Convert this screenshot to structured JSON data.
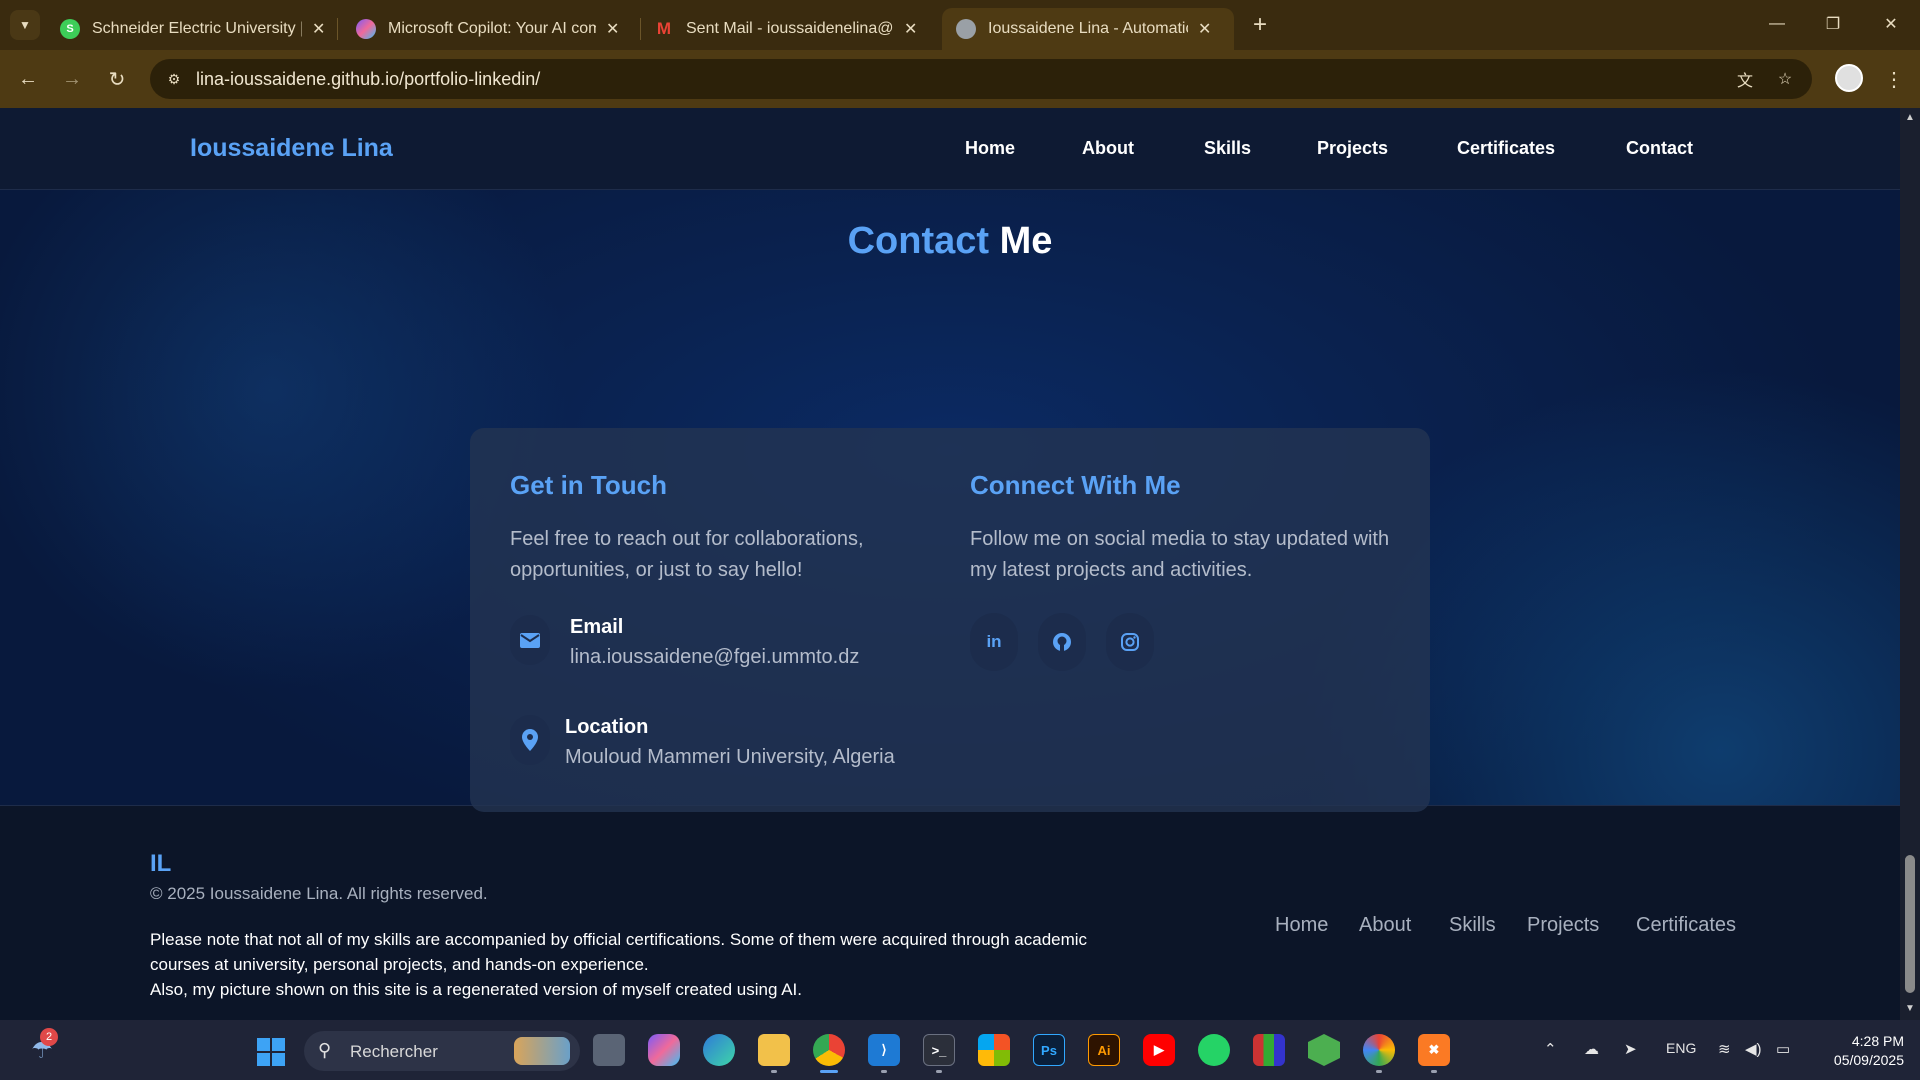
{
  "browser": {
    "tabs": [
      {
        "title": "Schneider Electric University | b",
        "favicon": "schneider-icon",
        "color": "#3dcd58"
      },
      {
        "title": "Microsoft Copilot: Your AI comp",
        "favicon": "copilot-icon",
        "color": "#7a5af8"
      },
      {
        "title": "Sent Mail - ioussaidenelina@gm",
        "favicon": "gmail-icon",
        "color": "#ea4335"
      },
      {
        "title": "Ioussaidene Lina - Automation",
        "favicon": "globe-icon",
        "color": "#9aa0a6"
      }
    ],
    "url_host": "lina-ioussaidene.github.io",
    "url_path": "/portfolio-linkedin/"
  },
  "site": {
    "brand": "Ioussaidene Lina",
    "nav": [
      "Home",
      "About",
      "Skills",
      "Projects",
      "Certificates",
      "Contact"
    ]
  },
  "contact": {
    "title_highlight": "Contact",
    "title_rest": "Me",
    "touch": {
      "title": "Get in Touch",
      "text": "Feel free to reach out for collaborations, opportunities, or just to say hello!",
      "email_label": "Email",
      "email_value": "lina.ioussaidene@fgei.ummto.dz",
      "location_label": "Location",
      "location_value": "Mouloud Mammeri University, Algeria"
    },
    "connect": {
      "title": "Connect With Me",
      "text": "Follow me on social media to stay updated with my latest projects and activities.",
      "socials": [
        "linkedin-icon",
        "github-icon",
        "instagram-icon"
      ]
    }
  },
  "footer": {
    "logo": "IL",
    "copyright": "© 2025 Ioussaidene Lina. All rights reserved.",
    "note_line1": "Please note that not all of my skills are accompanied by official certifications. Some of them were acquired through academic",
    "note_line2": "courses at university, personal projects, and hands-on experience.",
    "note_line3": "Also, my picture shown on this site is a regenerated version of myself created using AI.",
    "links": [
      "Home",
      "About",
      "Skills",
      "Projects",
      "Certificates"
    ]
  },
  "taskbar": {
    "weather_badge": "2",
    "search_placeholder": "Rechercher",
    "lang": "ENG",
    "time": "4:28 PM",
    "date": "05/09/2025"
  },
  "colors": {
    "accent": "#5aa2f5",
    "chrome": "#4e3a13"
  }
}
